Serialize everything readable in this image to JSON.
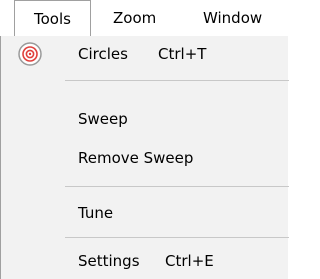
{
  "menubar": {
    "items": [
      {
        "label": "Tools"
      },
      {
        "label": "Zoom"
      },
      {
        "label": "Window"
      }
    ]
  },
  "tools_menu": {
    "items": [
      {
        "label": "Circles",
        "shortcut": "Ctrl+T",
        "icon": "circles-icon"
      },
      {
        "label": "Sweep"
      },
      {
        "label": "Remove Sweep"
      },
      {
        "label": "Tune"
      },
      {
        "label": "Settings",
        "shortcut": "Ctrl+E"
      }
    ]
  },
  "colors": {
    "menu_background": "#f2f2f2",
    "icon_ring": "#e0403c"
  }
}
